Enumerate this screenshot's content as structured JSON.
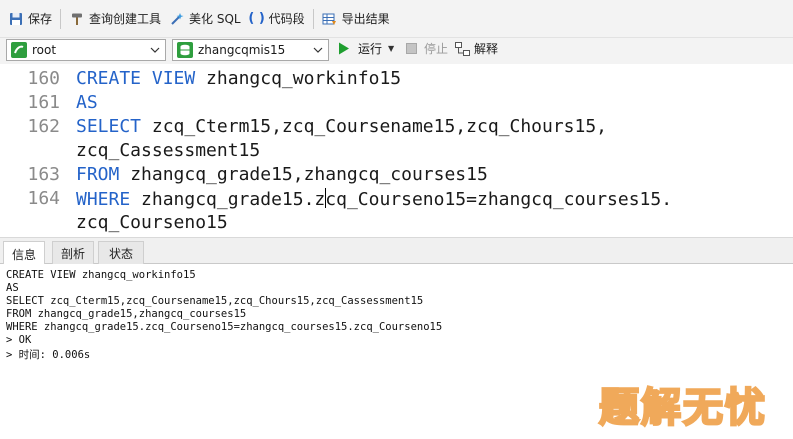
{
  "toolbar": {
    "save_label": "保存",
    "query_builder_label": "查询创建工具",
    "beautify_sql_label": "美化 SQL",
    "code_snippet_label": "代码段",
    "export_result_label": "导出结果"
  },
  "connection": {
    "user": "root",
    "database": "zhangcqmis15",
    "run_label": "运行",
    "stop_label": "停止",
    "explain_label": "解释"
  },
  "editor": {
    "lines": [
      {
        "number": "160",
        "keyword": "CREATE VIEW",
        "text": " zhangcq_workinfo15"
      },
      {
        "number": "161",
        "keyword": "AS",
        "text": ""
      },
      {
        "number": "162",
        "keyword": "SELECT",
        "text": " zcq_Cterm15,zcq_Coursename15,zcq_Chours15,"
      },
      {
        "number": "",
        "keyword": "",
        "text": "zcq_Cassessment15"
      },
      {
        "number": "163",
        "keyword": "FROM",
        "text": " zhangcq_grade15,zhangcq_courses15"
      },
      {
        "number": "164",
        "keyword": "WHERE",
        "text_before_caret": " zhangcq_grade15.z",
        "text_after_caret": "cq_Courseno15=zhangcq_courses15."
      },
      {
        "number": "",
        "keyword": "",
        "text": "zcq_Courseno15"
      }
    ]
  },
  "tabs": [
    {
      "label": "信息",
      "active": true
    },
    {
      "label": "剖析",
      "active": false
    },
    {
      "label": "状态",
      "active": false
    }
  ],
  "output": {
    "lines": [
      "CREATE VIEW zhangcq_workinfo15",
      "AS",
      "SELECT zcq_Cterm15,zcq_Coursename15,zcq_Chours15,zcq_Cassessment15",
      "FROM zhangcq_grade15,zhangcq_courses15",
      "WHERE zhangcq_grade15.zcq_Courseno15=zhangcq_courses15.zcq_Courseno15",
      "> OK",
      "> 时间: 0.006s"
    ]
  },
  "watermark": {
    "text": "题解无忧"
  },
  "colors": {
    "keyword": "#2463c9",
    "line_number": "#8a8a8a",
    "run_green": "#1e9e2f",
    "watermark": "#f0a95a"
  }
}
